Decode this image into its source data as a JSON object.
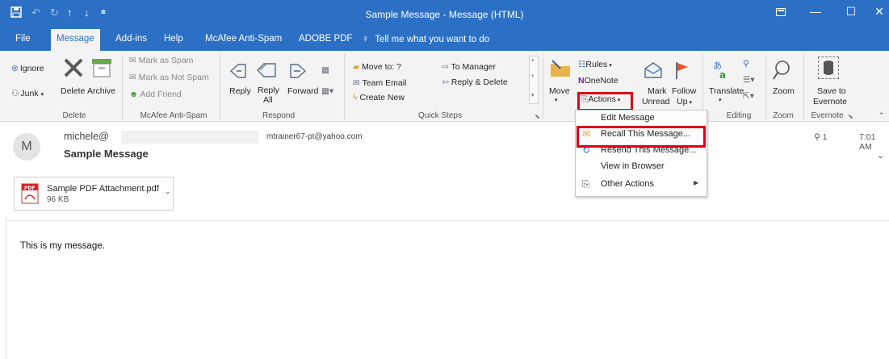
{
  "window": {
    "title": "Sample Message  -  Message (HTML)",
    "qat": [
      "save-icon",
      "undo-icon",
      "redo-icon",
      "up-arrow-icon",
      "down-arrow-icon",
      "customize-icon"
    ]
  },
  "tabs": [
    "File",
    "Message",
    "Add-ins",
    "Help",
    "McAfee Anti-Spam",
    "ADOBE PDF"
  ],
  "tell_me": "Tell me what you want to do",
  "ribbon": {
    "delete_group": {
      "label": "Delete",
      "ignore": "Ignore",
      "junk": "Junk",
      "delete": "Delete",
      "archive": "Archive"
    },
    "mcafee_group": {
      "label": "McAfee Anti-Spam",
      "mark_spam": "Mark as Spam",
      "mark_not_spam": "Mark as Not Spam",
      "add_friend": "Add Friend"
    },
    "respond_group": {
      "label": "Respond",
      "reply": "Reply",
      "reply_all_1": "Reply",
      "reply_all_2": "All",
      "forward": "Forward"
    },
    "quick_steps_group": {
      "label": "Quick Steps",
      "move_to": "Move to: ?",
      "team_email": "Team Email",
      "create_new": "Create New",
      "to_manager": "To Manager",
      "reply_delete": "Reply & Delete"
    },
    "move_group": {
      "move": "Move",
      "rules": "Rules",
      "onenote": "OneNote",
      "actions": "Actions"
    },
    "tags_group": {
      "mark_unread_1": "Mark",
      "mark_unread_2": "Unread",
      "follow_up_1": "Follow",
      "follow_up_2": "Up"
    },
    "editing_group": {
      "label": "Editing",
      "translate": "Translate"
    },
    "zoom_group": {
      "label": "Zoom",
      "zoom": "Zoom"
    },
    "evernote_group": {
      "label": "Evernote",
      "save_to_1": "Save to",
      "save_to_2": "Evernote"
    }
  },
  "actions_menu": {
    "items": [
      {
        "label": "Edit Message"
      },
      {
        "label": "Recall This Message..."
      },
      {
        "label": "Resend This Message..."
      },
      {
        "label": "View in Browser"
      },
      {
        "label": "Other Actions"
      }
    ]
  },
  "message": {
    "avatar_initial": "M",
    "from": "michele@",
    "subject": "Sample Message",
    "to": "mtrainer67-pt@yahoo.com",
    "attachment_count": "1",
    "time": "7:01 AM",
    "attachment": {
      "name": "Sample PDF Attachment.pdf",
      "size": "96 KB"
    },
    "body": "This is my message."
  },
  "colors": {
    "accent": "#2b70c4",
    "highlight": "#e0001a"
  }
}
